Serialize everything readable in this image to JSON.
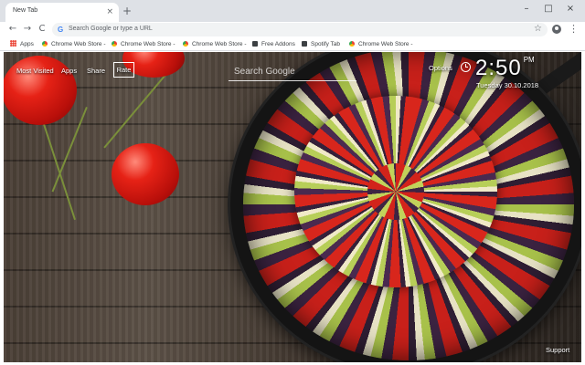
{
  "browser": {
    "tab_title": "New Tab",
    "tab_close": "×",
    "new_tab": "+",
    "window_controls": [
      "–",
      "□",
      "×"
    ],
    "nav": {
      "back": "←",
      "forward": "→",
      "reload": "C"
    },
    "omnibox": {
      "g_letter": "G",
      "placeholder": "Search Google or type a URL"
    },
    "star": "☆",
    "menu": "⋮",
    "bookmarks": [
      {
        "label": "Apps",
        "icon": "apps-grid-icon"
      },
      {
        "label": "Chrome Web Store -",
        "icon": "chrome-web-store-icon"
      },
      {
        "label": "Chrome Web Store -",
        "icon": "chrome-web-store-icon"
      },
      {
        "label": "Chrome Web Store -",
        "icon": "chrome-web-store-icon"
      },
      {
        "label": "Free Addons",
        "icon": "addons-icon"
      },
      {
        "label": "Spotify Tab",
        "icon": "spotify-icon"
      },
      {
        "label": "Chrome Web Store -",
        "icon": "chrome-web-store-icon"
      }
    ]
  },
  "newtab": {
    "nav": {
      "most_visited": "Most Visited",
      "apps": "Apps",
      "share": "Share",
      "rate": "Rate"
    },
    "search": {
      "placeholder": "Search Google"
    },
    "options": "Options",
    "time": "2:50",
    "time_suffix": "PM",
    "date": "Tuesday  30.10.2018",
    "support": "Support"
  },
  "colors": {
    "tabstrip_bg": "#dee1e6",
    "omnibox_bg": "#f1f3f4",
    "text_on_image": "#ffffff"
  }
}
